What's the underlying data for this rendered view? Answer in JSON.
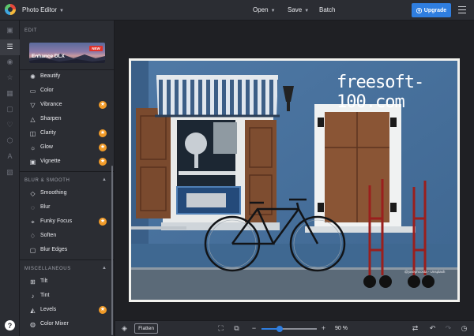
{
  "header": {
    "app_title": "Photo Editor",
    "menu": [
      "Open",
      "Save",
      "Batch"
    ],
    "upgrade_label": "Upgrade"
  },
  "rail": {
    "icons": [
      "image-icon",
      "sliders-icon",
      "eye-icon",
      "star-icon",
      "grid-icon",
      "frame-icon",
      "heart-icon",
      "shape-icon",
      "text-icon",
      "texture-icon"
    ],
    "help_label": "?"
  },
  "panel": {
    "edit_title": "EDIT",
    "enhance": {
      "label": "Enhance DLX",
      "badge": "NEW"
    },
    "edit_items": [
      {
        "label": "Beautify",
        "icon": "beautify-icon",
        "premium": false
      },
      {
        "label": "Color",
        "icon": "color-icon",
        "premium": false
      },
      {
        "label": "Vibrance",
        "icon": "vibrance-icon",
        "premium": true
      },
      {
        "label": "Sharpen",
        "icon": "sharpen-icon",
        "premium": false
      },
      {
        "label": "Clarity",
        "icon": "clarity-icon",
        "premium": true
      },
      {
        "label": "Glow",
        "icon": "glow-icon",
        "premium": true
      },
      {
        "label": "Vignette",
        "icon": "vignette-icon",
        "premium": true
      }
    ],
    "blur_title": "BLUR & SMOOTH",
    "blur_items": [
      {
        "label": "Smoothing",
        "icon": "smoothing-icon",
        "premium": false
      },
      {
        "label": "Blur",
        "icon": "blur-icon",
        "premium": false
      },
      {
        "label": "Funky Focus",
        "icon": "funky-focus-icon",
        "premium": true
      },
      {
        "label": "Soften",
        "icon": "soften-icon",
        "premium": false
      },
      {
        "label": "Blur Edges",
        "icon": "blur-edges-icon",
        "premium": false
      }
    ],
    "misc_title": "MISCELLANEOUS",
    "misc_items": [
      {
        "label": "Tilt",
        "icon": "tilt-icon",
        "premium": false
      },
      {
        "label": "Tint",
        "icon": "tint-icon",
        "premium": false
      },
      {
        "label": "Levels",
        "icon": "levels-icon",
        "premium": true
      },
      {
        "label": "Color Mixer",
        "icon": "color-mixer-icon",
        "premium": false
      }
    ]
  },
  "canvas": {
    "watermark": "freesoft-100.com",
    "credit": "@josephcosta - Unsplash"
  },
  "footer": {
    "flatten_label": "Flatten",
    "zoom_minus": "−",
    "zoom_plus": "+",
    "zoom_level": "90 %",
    "zoom_fraction": 0.33
  },
  "colors": {
    "accent": "#2f7ee0",
    "premium": "#f09a28",
    "badge": "#e0342c"
  }
}
